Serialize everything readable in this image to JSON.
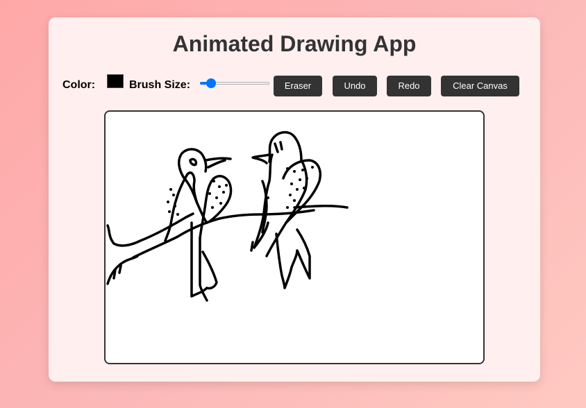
{
  "app": {
    "title": "Animated Drawing App"
  },
  "toolbar": {
    "color_label": "Color:",
    "color_value": "#000000",
    "brush_size_label": "Brush Size:",
    "brush_size_fraction": 0.1,
    "eraser_label": "Eraser",
    "undo_label": "Undo",
    "redo_label": "Redo",
    "clear_label": "Clear Canvas"
  },
  "canvas": {
    "background": "#ffffff",
    "stroke_color": "#000000"
  },
  "theme": {
    "accent": "#0075ff",
    "button_bg": "#333333",
    "button_text": "#ffffff"
  }
}
